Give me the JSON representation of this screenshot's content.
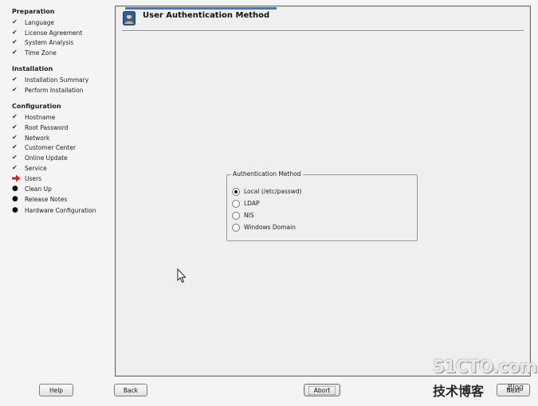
{
  "sidebar": {
    "sections": [
      {
        "title": "Preparation",
        "items": [
          {
            "label": "Language",
            "state": "done"
          },
          {
            "label": "License Agreement",
            "state": "done"
          },
          {
            "label": "System Analysis",
            "state": "done"
          },
          {
            "label": "Time Zone",
            "state": "done"
          }
        ]
      },
      {
        "title": "Installation",
        "items": [
          {
            "label": "Installation Summary",
            "state": "done"
          },
          {
            "label": "Perform Installation",
            "state": "done"
          }
        ]
      },
      {
        "title": "Configuration",
        "items": [
          {
            "label": "Hostname",
            "state": "done"
          },
          {
            "label": "Root Password",
            "state": "done"
          },
          {
            "label": "Network",
            "state": "done"
          },
          {
            "label": "Customer Center",
            "state": "done"
          },
          {
            "label": "Online Update",
            "state": "done"
          },
          {
            "label": "Service",
            "state": "done"
          },
          {
            "label": "Users",
            "state": "current"
          },
          {
            "label": "Clean Up",
            "state": "pending"
          },
          {
            "label": "Release Notes",
            "state": "pending"
          },
          {
            "label": "Hardware Configuration",
            "state": "pending"
          }
        ]
      }
    ],
    "icons": {
      "done": "check-icon",
      "current": "arrow-right-icon",
      "pending": "bullet-icon"
    },
    "current_color": "#d42020"
  },
  "main": {
    "title": "User Authentication Method",
    "title_icon": "user-icon",
    "auth_group": {
      "legend": "Authentication Method",
      "options": [
        {
          "label": "Local (/etc/passwd)",
          "selected": true
        },
        {
          "label": "LDAP",
          "selected": false
        },
        {
          "label": "NIS",
          "selected": false
        },
        {
          "label": "Windows Domain",
          "selected": false
        }
      ]
    }
  },
  "buttons": {
    "help": "Help",
    "back": "Back",
    "abort": "Abort",
    "next": "Next"
  },
  "watermark": {
    "main": "51CTO.com",
    "sub": "技术博客",
    "blog": "Blog"
  }
}
